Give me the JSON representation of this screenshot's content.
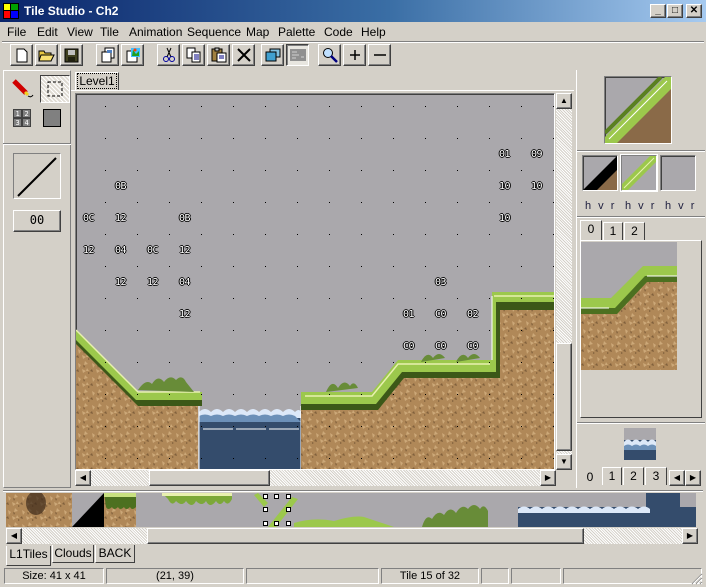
{
  "window": {
    "title": "Tile Studio - Ch2",
    "controls": {
      "minimize": "_",
      "maximize": "□",
      "close": "✕"
    }
  },
  "menu": [
    "File",
    "Edit",
    "View",
    "Tile",
    "Animation",
    "Sequence",
    "Map",
    "Palette",
    "Code",
    "Help"
  ],
  "toolbar": [
    {
      "name": "new-icon",
      "glyph": "🗋"
    },
    {
      "name": "open-folder-icon",
      "glyph": "📂"
    },
    {
      "name": "save-icon",
      "glyph": "💾"
    },
    {
      "name": "duplicate-tile-icon",
      "glyph": "❐"
    },
    {
      "name": "import-image-icon",
      "glyph": "🖼"
    },
    {
      "name": "cut-icon",
      "glyph": "✂"
    },
    {
      "name": "copy-icon",
      "glyph": "⎘"
    },
    {
      "name": "paste-icon",
      "glyph": "📋"
    },
    {
      "name": "delete-icon",
      "glyph": "✕"
    },
    {
      "name": "layers-icon",
      "glyph": "❏"
    },
    {
      "name": "map-view-icon",
      "glyph": "▤"
    },
    {
      "name": "zoom-icon",
      "glyph": "🔍"
    },
    {
      "name": "zoom-in-icon",
      "glyph": "+"
    },
    {
      "name": "zoom-out-icon",
      "glyph": "—"
    }
  ],
  "tools": {
    "pencil": "pencil-icon",
    "select": "selection-rect-icon",
    "tile_numbers": "tile-numbers-icon",
    "color": "color-swatch-icon",
    "line_preview": "line-tool-icon",
    "value_button": "00"
  },
  "map": {
    "tab": "Level1",
    "bounds_labels": [
      {
        "text": "01",
        "col": 13,
        "row": 1
      },
      {
        "text": "09",
        "col": 14,
        "row": 1
      },
      {
        "text": "0B",
        "col": 1,
        "row": 2
      },
      {
        "text": "10",
        "col": 13,
        "row": 2
      },
      {
        "text": "10",
        "col": 14,
        "row": 2
      },
      {
        "text": "0C",
        "col": 0,
        "row": 3
      },
      {
        "text": "12",
        "col": 1,
        "row": 3
      },
      {
        "text": "0B",
        "col": 3,
        "row": 3
      },
      {
        "text": "10",
        "col": 13,
        "row": 3
      },
      {
        "text": "12",
        "col": 0,
        "row": 4
      },
      {
        "text": "04",
        "col": 1,
        "row": 4
      },
      {
        "text": "0C",
        "col": 2,
        "row": 4
      },
      {
        "text": "12",
        "col": 3,
        "row": 4
      },
      {
        "text": "12",
        "col": 1,
        "row": 5
      },
      {
        "text": "12",
        "col": 2,
        "row": 5
      },
      {
        "text": "04",
        "col": 3,
        "row": 5
      },
      {
        "text": "03",
        "col": 11,
        "row": 5
      },
      {
        "text": "12",
        "col": 3,
        "row": 6
      },
      {
        "text": "01",
        "col": 10,
        "row": 6
      },
      {
        "text": "C0",
        "col": 11,
        "row": 6
      },
      {
        "text": "02",
        "col": 12,
        "row": 6
      },
      {
        "text": "C0",
        "col": 10,
        "row": 7
      },
      {
        "text": "C0",
        "col": 11,
        "row": 7
      },
      {
        "text": "C0",
        "col": 12,
        "row": 7
      }
    ]
  },
  "right_panel": {
    "tile_preview": "current-tile-preview",
    "layers": [
      {
        "flags": "h v r"
      },
      {
        "flags": "h v r"
      },
      {
        "flags": "h v r"
      }
    ],
    "layer_tabs": [
      "0",
      "1",
      "2"
    ],
    "pattern_tabs": [
      "0",
      "1",
      "2",
      "3"
    ]
  },
  "tileset_tabs": [
    "L1Tiles",
    "Clouds",
    "BACK"
  ],
  "status": {
    "size": "Size: 41 x 41",
    "cursor": "(21, 39)",
    "panel3": "",
    "tile": "Tile 15 of 32",
    "panel5": "",
    "panel6": "",
    "panel7": ""
  },
  "colors": {
    "sky": "#aaa8ac",
    "water": "#344c6c",
    "grass": "#9cc84c",
    "ground": "#b08858",
    "title_start": "#0a246a",
    "title_end": "#a6caf0"
  }
}
